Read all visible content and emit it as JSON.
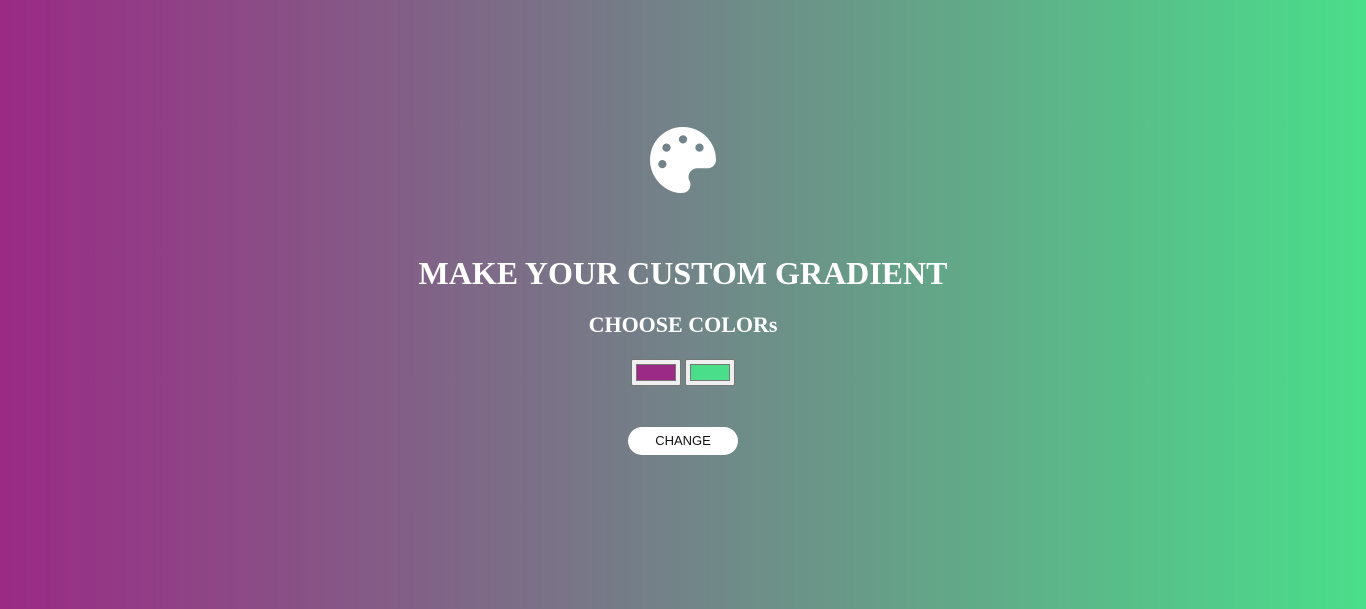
{
  "header": {
    "icon": "palette-icon",
    "title": "MAKE YOUR CUSTOM GRADIENT",
    "subtitle": "CHOOSE COLORs"
  },
  "colors": {
    "color1": "#9a2a85",
    "color2": "#4ade8a"
  },
  "actions": {
    "change_label": "CHANGE"
  }
}
